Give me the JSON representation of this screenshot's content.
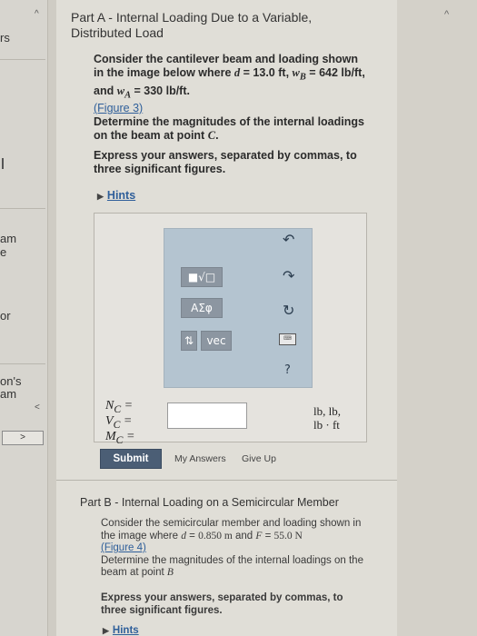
{
  "sidebar": {
    "fragments": [
      {
        "text": "rs",
        "y": 0
      },
      {
        "text": "am",
        "y": 0
      },
      {
        "text": "e",
        "y": 0
      },
      {
        "text": "or",
        "y": 0
      },
      {
        "text": "on's",
        "y": 0
      },
      {
        "text": "am",
        "y": 0
      }
    ],
    "next_button": ">",
    "collapse_chevron": "<"
  },
  "header": {
    "collapse_icon": "^"
  },
  "part_a": {
    "title_prefix": "Part A",
    "title_sep": " - ",
    "title_text": "Internal Loading Due to a Variable, Distributed Load",
    "intro_1": "Consider the cantilever beam and loading shown in the image below where",
    "d_label": "d",
    "d_value": "13.0 ft",
    "wb_label": "w",
    "wb_sub": "B",
    "wb_value": "642 lb/ft",
    "and_word": "and",
    "wa_label": "w",
    "wa_sub": "A",
    "wa_value": "330 lb/ft",
    "figure_link": "(Figure 3)",
    "question": "Determine the magnitudes of the internal loadings on the beam at point",
    "point": "C",
    "instructions": "Express your answers, separated by commas, to three significant figures.",
    "hints_label": "Hints",
    "toolbar": {
      "template_btn": "■√□",
      "greek_btn": "ΑΣφ",
      "arrows_btn": "⇅",
      "vec_btn": "vec",
      "undo_icon": "↶",
      "redo_icon": "↷",
      "reset_icon": "↻",
      "keyboard_icon": "⌨",
      "help_icon": "?"
    },
    "answer_vars": [
      "N",
      "V",
      "M"
    ],
    "answer_sub": "C",
    "answer_value": "",
    "units_line1": "lb, lb,",
    "units_line2": "lb · ft",
    "submit_label": "Submit",
    "my_answers_label": "My Answers",
    "give_up_label": "Give Up"
  },
  "part_b": {
    "title_prefix": "Part B",
    "title_sep": " - ",
    "title_text": "Internal Loading on a Semicircular Member",
    "intro": "Consider the semicircular member and loading shown in the image where",
    "d_label": "d",
    "d_value": "0.850 m",
    "and_word": "and",
    "f_label": "F",
    "f_value": "55.0 N",
    "figure_link": "(Figure 4)",
    "question": "Determine the magnitudes of the internal loadings on the beam at point",
    "point": "B",
    "instructions": "Express your answers, separated by commas, to three significant figures.",
    "hints_label": "Hints"
  },
  "colors": {
    "link": "#2f5f9a",
    "submit_bg": "#4b5e75",
    "toolbar_bg": "#b4c4d0"
  }
}
